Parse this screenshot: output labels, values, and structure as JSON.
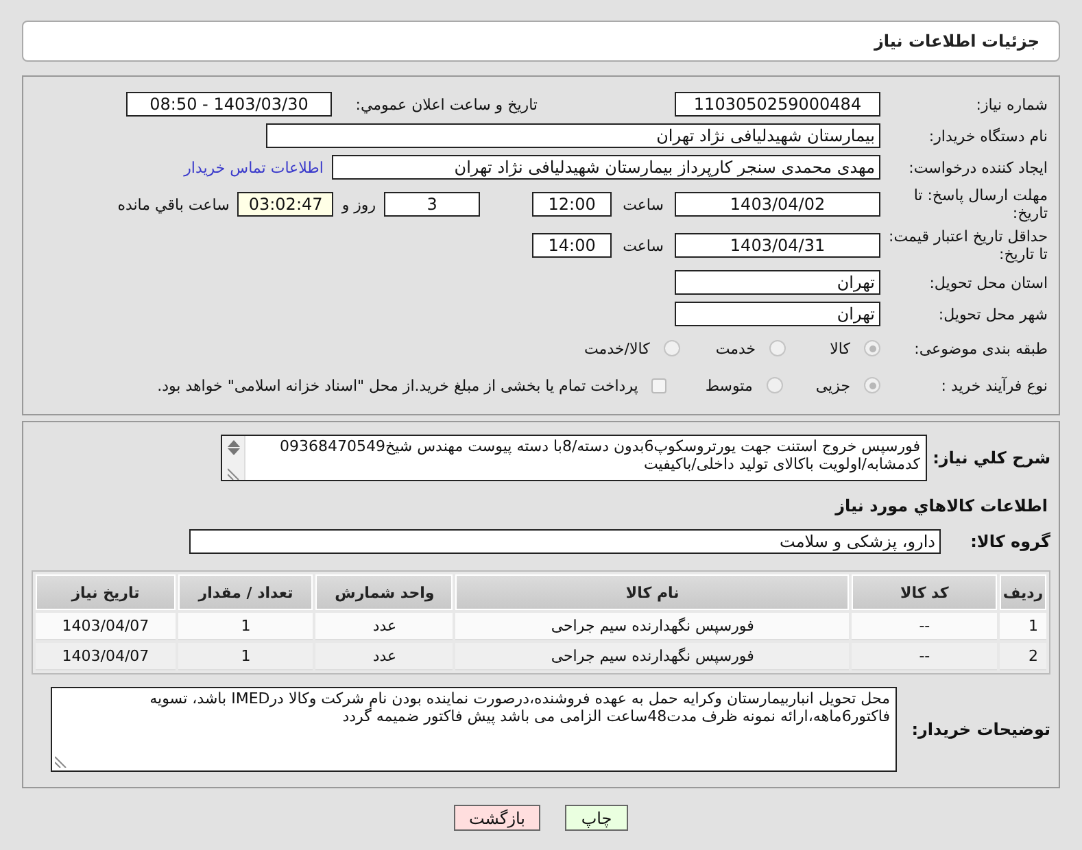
{
  "header": {
    "title": "جزئیات اطلاعات نیاز"
  },
  "need_number": {
    "label": "شماره نیاز:",
    "value": "1103050259000484"
  },
  "announce": {
    "label": "تاریخ و ساعت اعلان عمومي:",
    "value": "1403/03/30 - 08:50"
  },
  "buyer_org": {
    "label": "نام دستگاه خریدار:",
    "value": "بیمارستان شهیدلیافی نژاد تهران"
  },
  "creator": {
    "label": "ایجاد کننده درخواست:",
    "value": "مهدی محمدی سنجر کارپرداز بیمارستان شهیدلیافی نژاد تهران",
    "link": "اطلاعات تماس خریدار"
  },
  "reply_deadline": {
    "label": "مهلت ارسال پاسخ: تا تاریخ:",
    "date": "1403/04/02",
    "time_label": "ساعت",
    "time": "12:00",
    "days": "3",
    "days_label": "روز و",
    "remaining": "03:02:47",
    "remaining_label": "ساعت باقي مانده"
  },
  "price_validity": {
    "label": "حداقل تاریخ اعتبار قیمت: تا تاریخ:",
    "date": "1403/04/31",
    "time_label": "ساعت",
    "time": "14:00"
  },
  "province": {
    "label": "استان محل تحویل:",
    "value": "تهران"
  },
  "city": {
    "label": "شهر محل تحویل:",
    "value": "تهران"
  },
  "category": {
    "label": "طبقه بندی موضوعی:",
    "options": [
      {
        "label": "کالا",
        "selected": true
      },
      {
        "label": "خدمت",
        "selected": false
      },
      {
        "label": "کالا/خدمت",
        "selected": false
      }
    ]
  },
  "purchase_type": {
    "label": "نوع فرآیند خرید :",
    "options": [
      {
        "label": "جزیی",
        "selected": true
      },
      {
        "label": "متوسط",
        "selected": false
      }
    ],
    "treasury": {
      "label": "پرداخت تمام یا بخشی از مبلغ خرید.از محل \"اسناد خزانه اسلامی\" خواهد بود.",
      "checked": false
    }
  },
  "summary": {
    "label": "شرح کلي نیاز:",
    "value": "فورسپس خروج استنت جهت یورتروسکوپ6بدون دسته/8با دسته پیوست مهندس شیخ09368470549 کدمشابه/اولویت باکالای تولید داخلی/باکیفیت"
  },
  "goods_title": "اطلاعات کالاهاي مورد نیاز",
  "goods_group": {
    "label": "گروه کالا:",
    "value": "دارو، پزشکی و سلامت"
  },
  "table": {
    "columns": [
      "ردیف",
      "کد کالا",
      "نام کالا",
      "واحد شمارش",
      "تعداد / مقدار",
      "تاریخ نیاز"
    ],
    "rows": [
      [
        "1",
        "--",
        "فورسپس نگهدارنده سیم جراحی",
        "عدد",
        "1",
        "1403/04/07"
      ],
      [
        "2",
        "--",
        "فورسپس نگهدارنده سیم جراحی",
        "عدد",
        "1",
        "1403/04/07"
      ]
    ]
  },
  "buyer_notes": {
    "label": "توضیحات خریدار:",
    "value": "محل تحویل انباربیمارستان وکرایه حمل به عهده فروشنده،درصورت نماینده بودن نام شرکت وکالا درIMED باشد، تسویه فاکتور6ماهه،ارائه نمونه ظرف مدت48ساعت الزامی می باشد پیش فاکتور ضمیمه گردد"
  },
  "buttons": [
    {
      "label": "چاپ",
      "kind": "print"
    },
    {
      "label": "بازگشت",
      "kind": "back"
    }
  ]
}
